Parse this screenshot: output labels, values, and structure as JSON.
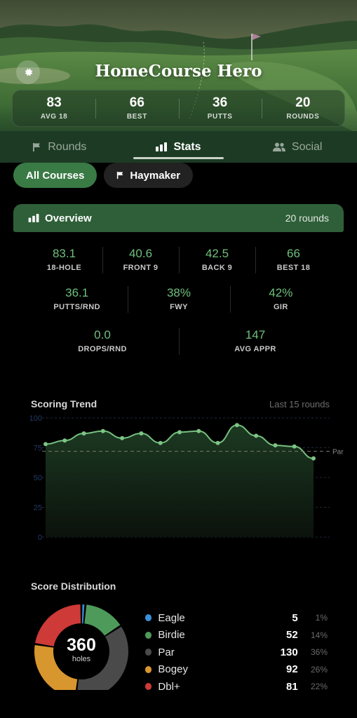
{
  "app": {
    "title": "HomeCourse Hero"
  },
  "summary_stats": [
    {
      "value": "83",
      "label": "AVG 18"
    },
    {
      "value": "66",
      "label": "BEST"
    },
    {
      "value": "36",
      "label": "PUTTS"
    },
    {
      "value": "20",
      "label": "ROUNDS"
    }
  ],
  "tabs": [
    {
      "label": "Rounds",
      "icon": "flag-icon",
      "active": false
    },
    {
      "label": "Stats",
      "icon": "bar-chart-icon",
      "active": true
    },
    {
      "label": "Social",
      "icon": "people-icon",
      "active": false
    }
  ],
  "filters": [
    {
      "label": "All Courses",
      "active": true
    },
    {
      "label": "Haymaker",
      "icon": "flag-icon",
      "active": false
    }
  ],
  "overview": {
    "title": "Overview",
    "count_label": "20 rounds",
    "row1": [
      {
        "value": "83.1",
        "label": "18-HOLE"
      },
      {
        "value": "40.6",
        "label": "FRONT 9"
      },
      {
        "value": "42.5",
        "label": "BACK 9"
      },
      {
        "value": "66",
        "label": "BEST 18"
      }
    ],
    "row2": [
      {
        "value": "36.1",
        "label": "PUTTS/RND"
      },
      {
        "value": "38%",
        "label": "FWY"
      },
      {
        "value": "42%",
        "label": "GIR"
      }
    ],
    "row3": [
      {
        "value": "0.0",
        "label": "DROPS/RND"
      },
      {
        "value": "147",
        "label": "AVG APPR"
      }
    ]
  },
  "trend": {
    "title": "Scoring Trend",
    "subtitle": "Last 15 rounds",
    "par_label": "Par"
  },
  "chart_data": [
    {
      "type": "area",
      "title": "Scoring Trend",
      "subtitle": "Last 15 rounds",
      "ylim": [
        0,
        100
      ],
      "yticks": [
        "100",
        "75",
        "50",
        "25",
        "0"
      ],
      "reference_line": {
        "label": "Par",
        "value": 72
      },
      "series": [
        {
          "values": [
            78,
            81,
            87,
            89,
            83,
            87,
            79,
            88,
            89,
            79,
            94,
            85,
            77,
            76,
            66
          ]
        }
      ],
      "grid": true
    },
    {
      "type": "pie",
      "title": "Score Distribution",
      "center_value": "360",
      "center_label": "holes",
      "categories": [
        "Eagle",
        "Birdie",
        "Par",
        "Bogey",
        "Dbl+"
      ],
      "values": [
        5,
        52,
        130,
        92,
        81
      ],
      "percents": [
        "1%",
        "14%",
        "36%",
        "26%",
        "22%"
      ],
      "colors": [
        "#3b8fd8",
        "#4d9a5a",
        "#4a4a4a",
        "#d8962e",
        "#cd3a37"
      ]
    }
  ],
  "distribution": {
    "title": "Score Distribution",
    "total": "360",
    "total_label": "holes",
    "items": [
      {
        "name": "Eagle",
        "count": "5",
        "pct": "1%",
        "color": "#3b8fd8"
      },
      {
        "name": "Birdie",
        "count": "52",
        "pct": "14%",
        "color": "#4d9a5a"
      },
      {
        "name": "Par",
        "count": "130",
        "pct": "36%",
        "color": "#4a4a4a"
      },
      {
        "name": "Bogey",
        "count": "92",
        "pct": "26%",
        "color": "#d8962e"
      },
      {
        "name": "Dbl+",
        "count": "81",
        "pct": "22%",
        "color": "#cd3a37"
      }
    ]
  }
}
